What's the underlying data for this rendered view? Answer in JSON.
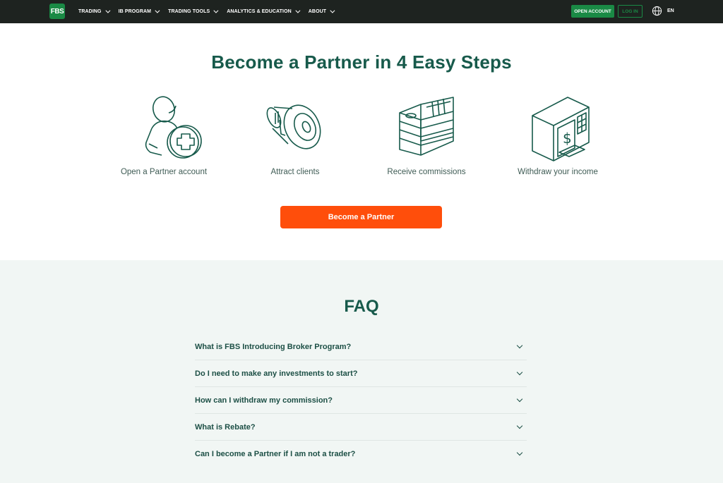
{
  "header": {
    "logo_text": "FBS",
    "nav": [
      {
        "label": "TRADING"
      },
      {
        "label": "IB PROGRAM"
      },
      {
        "label": "TRADING TOOLS"
      },
      {
        "label": "ANALYTICS & EDUCATION"
      },
      {
        "label": "ABOUT"
      }
    ],
    "open_account_label": "OPEN ACCOUNT",
    "login_label": "LOG IN",
    "language": "EN"
  },
  "steps_section": {
    "title": "Become a Partner in 4 Easy Steps",
    "steps": [
      {
        "label": "Open a Partner account",
        "icon": "user-add-icon"
      },
      {
        "label": "Attract clients",
        "icon": "megaphone-icon"
      },
      {
        "label": "Receive commissions",
        "icon": "money-stack-icon"
      },
      {
        "label": "Withdraw your income",
        "icon": "atm-icon"
      }
    ],
    "cta_label": "Become a Partner"
  },
  "faq": {
    "title": "FAQ",
    "items": [
      {
        "question": "What is FBS Introducing Broker Program?"
      },
      {
        "question": "Do I need to make any investments to start?"
      },
      {
        "question": "How can I withdraw my commission?"
      },
      {
        "question": "What is Rebate?"
      },
      {
        "question": "Can I become a Partner if I am not a trader?"
      }
    ]
  },
  "colors": {
    "topbar": "#1e2320",
    "brand_green": "#1a8a45",
    "heading": "#175a4b",
    "cta": "#ff4e0b",
    "faq_bg": "#f1f6f4"
  }
}
